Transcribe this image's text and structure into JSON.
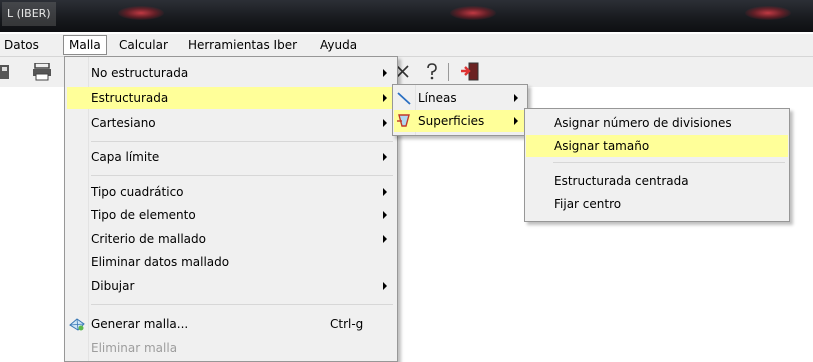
{
  "window": {
    "title": "L (IBER)"
  },
  "menubar": [
    "Datos",
    "Malla",
    "Calcular",
    "Herramientas Iber",
    "Ayuda"
  ],
  "malla_menu": {
    "items": [
      {
        "label": "No estructurada"
      },
      {
        "label": "Estructurada"
      },
      {
        "label": "Cartesiano"
      },
      {
        "label": "Capa límite"
      },
      {
        "label": "Tipo cuadrático"
      },
      {
        "label": "Tipo de elemento"
      },
      {
        "label": "Criterio de mallado"
      },
      {
        "label": "Eliminar datos mallado"
      },
      {
        "label": "Dibujar"
      },
      {
        "label": "Generar malla...",
        "shortcut": "Ctrl-g"
      },
      {
        "label": "Eliminar malla"
      }
    ]
  },
  "estructurada_menu": {
    "items": [
      {
        "label": "Líneas"
      },
      {
        "label": "Superficies"
      }
    ]
  },
  "superficies_menu": {
    "items": [
      {
        "label": "Asignar número de divisiones"
      },
      {
        "label": "Asignar tamaño"
      },
      {
        "label": "Estructurada centrada"
      },
      {
        "label": "Fijar centro"
      }
    ]
  },
  "colors": {
    "highlight": "#ffff99",
    "menu_bg": "#f0f0f0",
    "titlebar": "#16181c"
  },
  "icons": [
    "save-icon",
    "print-icon",
    "help-icon",
    "exit-icon",
    "generate-mesh-icon",
    "lines-icon",
    "surfaces-icon"
  ]
}
